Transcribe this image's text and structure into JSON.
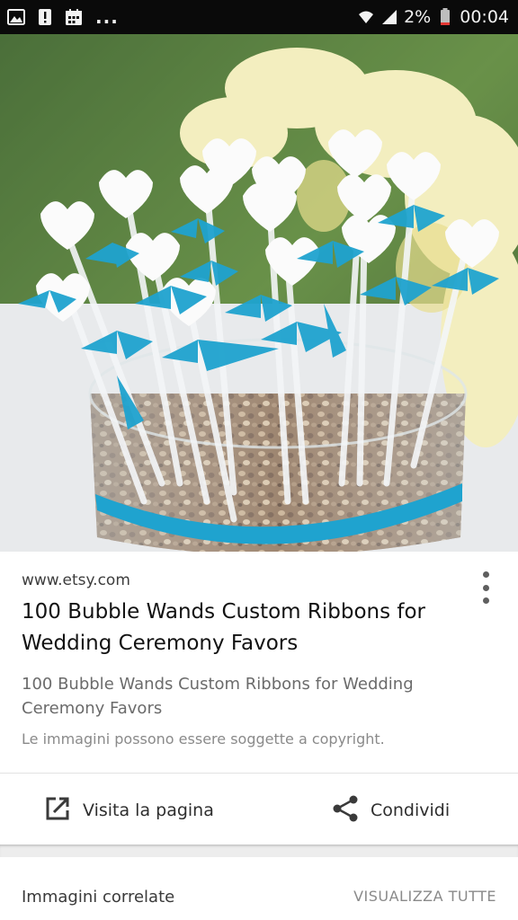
{
  "status_bar": {
    "icons": [
      "image-icon",
      "alert-icon",
      "calendar-icon",
      "wifi-icon",
      "signal-icon",
      "battery-icon"
    ],
    "more_indicator": "...",
    "battery": "2%",
    "time": "00:04"
  },
  "image_card": {
    "source": "www.etsy.com",
    "title": "100 Bubble Wands Custom Ribbons for Wedding Ceremony Favors",
    "description": "100 Bubble Wands Custom Ribbons for Wedding Ceremony Favors",
    "copyright_notice": "Le immagini possono essere soggette a copyright."
  },
  "actions": {
    "visit": {
      "label": "Visita la pagina",
      "icon": "open-in-new-icon"
    },
    "share": {
      "label": "Condividi",
      "icon": "share-icon"
    }
  },
  "related": {
    "label": "Immagini correlate",
    "view_all": "VISUALIZZA TUTTE"
  },
  "colors": {
    "ribbon": "#1fa3cf",
    "status_bar": "#0a0a0a",
    "background": "#ffffff"
  }
}
